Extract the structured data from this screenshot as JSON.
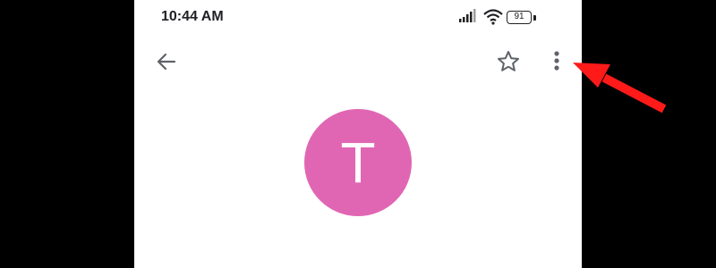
{
  "status_bar": {
    "time": "10:44 AM",
    "battery_level": "91",
    "icons": [
      "signal-icon",
      "wifi-icon",
      "battery-icon"
    ]
  },
  "toolbar": {
    "icons": [
      "back-arrow-icon",
      "star-icon",
      "more-vert-icon"
    ]
  },
  "contact": {
    "avatar_letter": "T",
    "avatar_color": "#e066b3"
  },
  "annotation": {
    "arrow_color": "#ff1a1a",
    "points_to": "more-options-button"
  }
}
